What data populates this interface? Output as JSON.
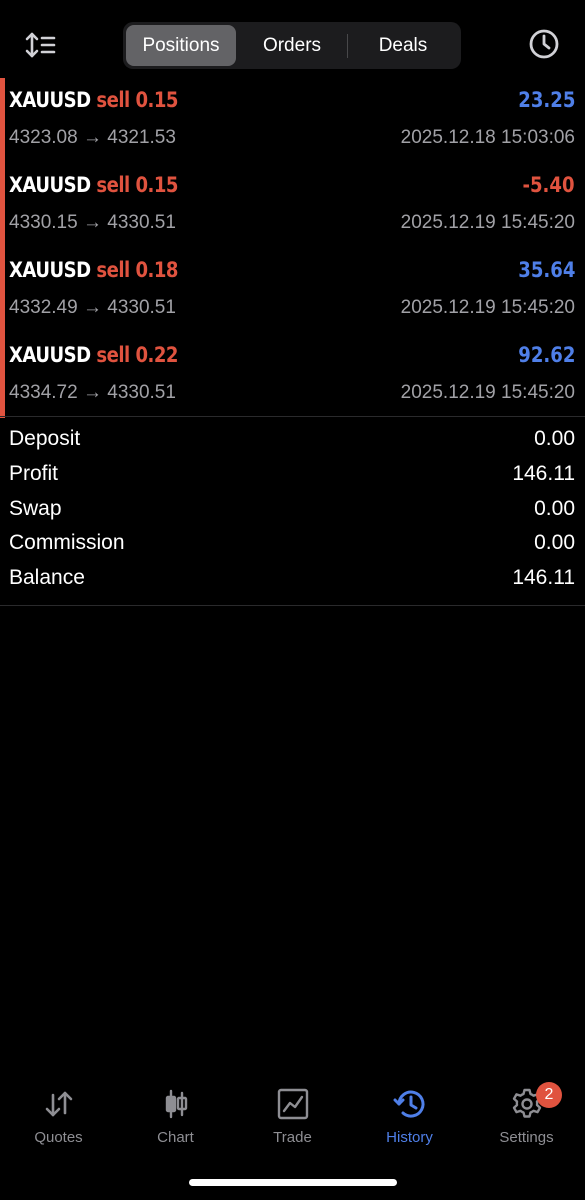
{
  "segments": [
    {
      "label": "Positions",
      "active": true
    },
    {
      "label": "Orders",
      "active": false
    },
    {
      "label": "Deals",
      "active": false
    }
  ],
  "positions": [
    {
      "symbol": "XAUUSD",
      "side": "sell",
      "volume": "0.15",
      "profit": "23.25",
      "open_price": "4323.08",
      "close_price": "4321.53",
      "time": "2025.12.18 15:03:06"
    },
    {
      "symbol": "XAUUSD",
      "side": "sell",
      "volume": "0.15",
      "profit": "-5.40",
      "open_price": "4330.15",
      "close_price": "4330.51",
      "time": "2025.12.19 15:45:20"
    },
    {
      "symbol": "XAUUSD",
      "side": "sell",
      "volume": "0.18",
      "profit": "35.64",
      "open_price": "4332.49",
      "close_price": "4330.51",
      "time": "2025.12.19 15:45:20"
    },
    {
      "symbol": "XAUUSD",
      "side": "sell",
      "volume": "0.22",
      "profit": "92.62",
      "open_price": "4334.72",
      "close_price": "4330.51",
      "time": "2025.12.19 15:45:20"
    }
  ],
  "arrow": "→",
  "summary": [
    {
      "label": "Deposit",
      "value": "0.00"
    },
    {
      "label": "Profit",
      "value": "146.11"
    },
    {
      "label": "Swap",
      "value": "0.00"
    },
    {
      "label": "Commission",
      "value": "0.00"
    },
    {
      "label": "Balance",
      "value": "146.11"
    }
  ],
  "tabs": [
    {
      "label": "Quotes",
      "icon": "quotes-arrows-icon"
    },
    {
      "label": "Chart",
      "icon": "candlestick-icon"
    },
    {
      "label": "Trade",
      "icon": "trade-chart-icon"
    },
    {
      "label": "History",
      "icon": "history-clock-icon",
      "active": true
    },
    {
      "label": "Settings",
      "icon": "gear-icon",
      "badge": "2"
    }
  ],
  "colors": {
    "sell": "#e0533f",
    "profit_positive": "#4f7fe8",
    "profit_negative": "#e0533f",
    "active_tab": "#4f7fe8",
    "muted": "#8e8e93"
  }
}
